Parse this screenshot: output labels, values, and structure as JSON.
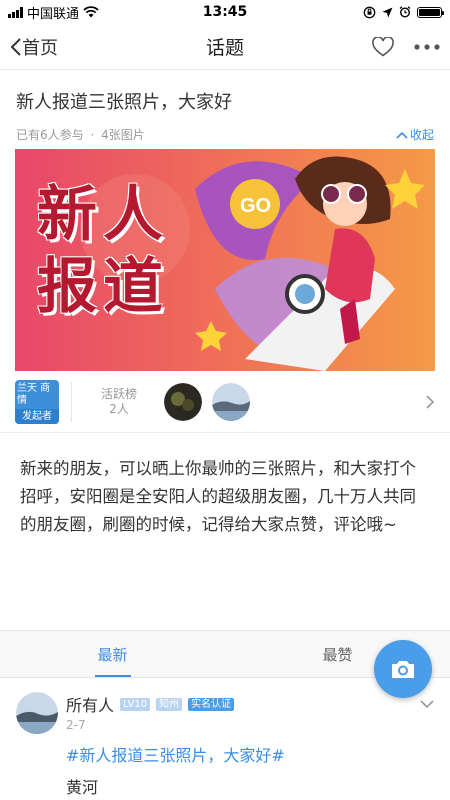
{
  "status": {
    "carrier": "中国联通",
    "time": "13:45"
  },
  "nav": {
    "back_label": "首页",
    "title": "话题"
  },
  "topic": {
    "title": "新人报道三张照片，大家好",
    "participants": "已有6人参与",
    "separator": "·",
    "photo_count": "4张图片",
    "collapse_label": "收起",
    "banner_line1": "新人",
    "banner_line2": "报道",
    "banner_go": "GO"
  },
  "activity": {
    "initiator_name": "兰天 商情",
    "initiator_badge": "发起者",
    "rank_label": "活跃榜",
    "rank_count": "2人"
  },
  "description": "新来的朋友，可以晒上你最帅的三张照片，和大家打个招呼，安阳圈是全安阳人的超级朋友圈，几十万人共同的朋友圈，刷圈的时候，记得给大家点赞，评论哦~",
  "tabs": [
    {
      "label": "最新",
      "active": true
    },
    {
      "label": "最赞",
      "active": false
    }
  ],
  "post": {
    "user": "所有人",
    "level": "LV10",
    "location": "知州",
    "verify": "实名认证",
    "date": "2-7",
    "hashtag": "#新人报道三张照片，大家好#",
    "text": "黄河"
  },
  "colors": {
    "accent": "#3a8ee6",
    "fab": "#4a9de8"
  }
}
